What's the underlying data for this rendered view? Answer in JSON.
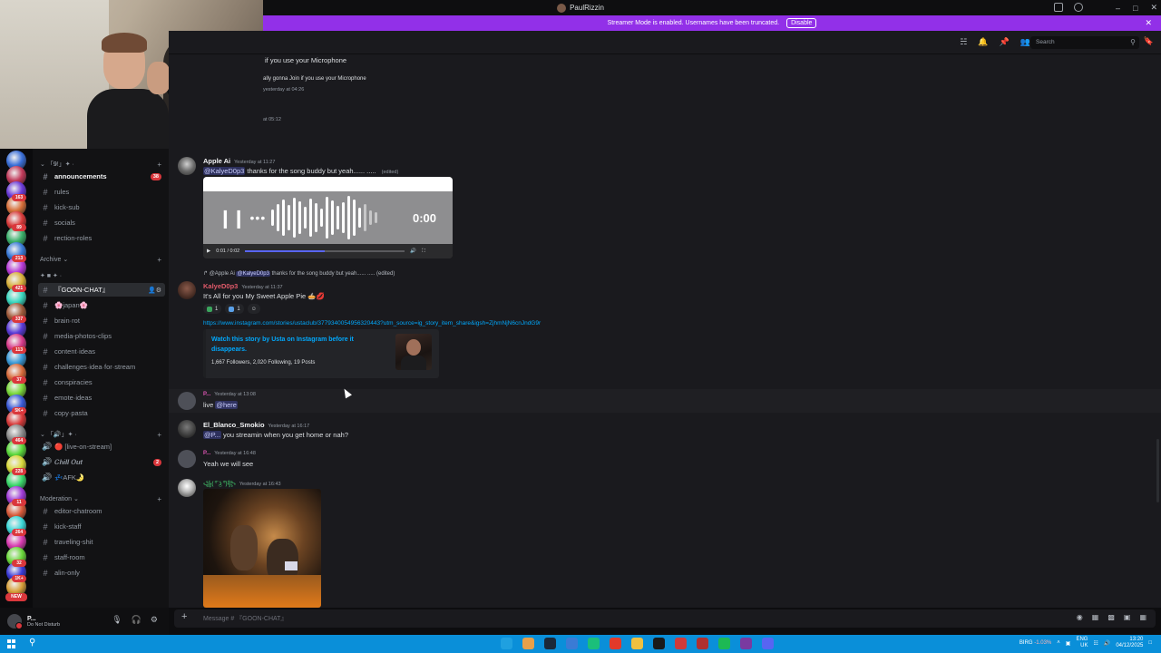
{
  "window": {
    "title": "PaulRizzin"
  },
  "banner": {
    "text": "Streamer Mode is enabled. Usernames have been truncated.",
    "disable_label": "Disable"
  },
  "header": {
    "search_placeholder": "Search"
  },
  "server_badges": [
    "163",
    "89",
    "213",
    "421",
    "337",
    "113",
    "37",
    "5K+",
    "464",
    "228",
    "11",
    "264",
    "32",
    "1K+"
  ],
  "new_badge": "NEW",
  "sidebar": {
    "top_category": "「𝟗!」✦ ·",
    "archive_category": "Archive",
    "chill_category": "✦ ■ ✦ ·",
    "voice_category": "「🔊」✦ ·",
    "moderation_category": "Moderation",
    "channels_top": [
      {
        "name": "announcements",
        "badge": "38"
      },
      {
        "name": "rules"
      },
      {
        "name": "kick-sub"
      },
      {
        "name": "socials"
      },
      {
        "name": "rection-roles"
      }
    ],
    "channels_chill": [
      {
        "name": "『GOON-CHAT』"
      },
      {
        "name": "🌸japan🌸"
      },
      {
        "name": "brain·rot"
      },
      {
        "name": "media-photos-clips"
      },
      {
        "name": "content·ideas"
      },
      {
        "name": "challenges·idea·for·stream"
      },
      {
        "name": "conspiracies"
      },
      {
        "name": "emote·ideas"
      },
      {
        "name": "copy·pasta"
      }
    ],
    "voice_channels": [
      {
        "name": "🔴 [live-on-stream]"
      },
      {
        "name": "𝑪𝒉𝒊𝒍𝒍 𝑶𝒖𝒕",
        "badge": "2"
      },
      {
        "name": "💤AFK🌛"
      }
    ],
    "moderation_channels": [
      {
        "name": "editor-chatroom"
      },
      {
        "name": "kick-staff"
      },
      {
        "name": "traveling-shit"
      },
      {
        "name": "staff-room"
      },
      {
        "name": "alin-only"
      }
    ]
  },
  "user_panel": {
    "name": "P...",
    "status": "Do Not Disturb"
  },
  "messages": {
    "top_fragment_1": "if you use your Microphone",
    "top_fragment_2": "ally gonna Join if you use your Microphone",
    "top_fragment_3": "yesterday at 04:26",
    "top_fragment_4": "at 05:12",
    "apple": {
      "author": "Apple Ai",
      "timestamp": "Yesterday at 11:27",
      "mention": "@KalyeD0p3",
      "text": " thanks for the song buddy but yeah...... .....",
      "edited": "(edited)",
      "audio_time": "0:00",
      "audio_ctrl_time": "0:01 / 0:02"
    },
    "kalye": {
      "reply_author": "@Apple Ai",
      "reply_mention": "@KalyeD0p3",
      "reply_text": " thanks for the song buddy but yeah...... ..... (edited)",
      "author": "KalyeD0p3",
      "timestamp": "Yesterday at 11:37",
      "text": "It's All for you My Sweet Apple Pie 🥧💋",
      "reaction_1": "1",
      "reaction_2": "1",
      "link": "https://www.instagram.com/stories/ustaclub/3779340054956320443?utm_source=ig_story_item_share&igsh=ZjhmNjN6cnJndG9r",
      "embed_title": "Watch this story by Usta on Instagram before it disappears.",
      "embed_stats": "1,667 Followers, 2,020 Following, 19 Posts"
    },
    "p1": {
      "author": "P...",
      "timestamp": "Yesterday at 13:08",
      "text_prefix": "live ",
      "mention": "@here"
    },
    "blanco": {
      "author": "El_Blanco_Smokio",
      "timestamp": "Yesterday at 16:17",
      "mention": "@P...",
      "text": " you streamin when you get home or nah?"
    },
    "p2": {
      "author": "P...",
      "timestamp": "Yesterday at 16:48",
      "text": "Yeah we will see"
    },
    "last": {
      "author": "꧁( ͡° ͜ʖ ͡°)꧂",
      "timestamp": "Yesterday at 16:43"
    }
  },
  "composer": {
    "placeholder": "Message # 『GOON-CHAT』"
  },
  "taskbar": {
    "stock_name": "BIRG",
    "stock_change": "-1.03%",
    "lang": "ENG",
    "region": "UK",
    "time": "13:20",
    "date": "04/12/2025"
  }
}
